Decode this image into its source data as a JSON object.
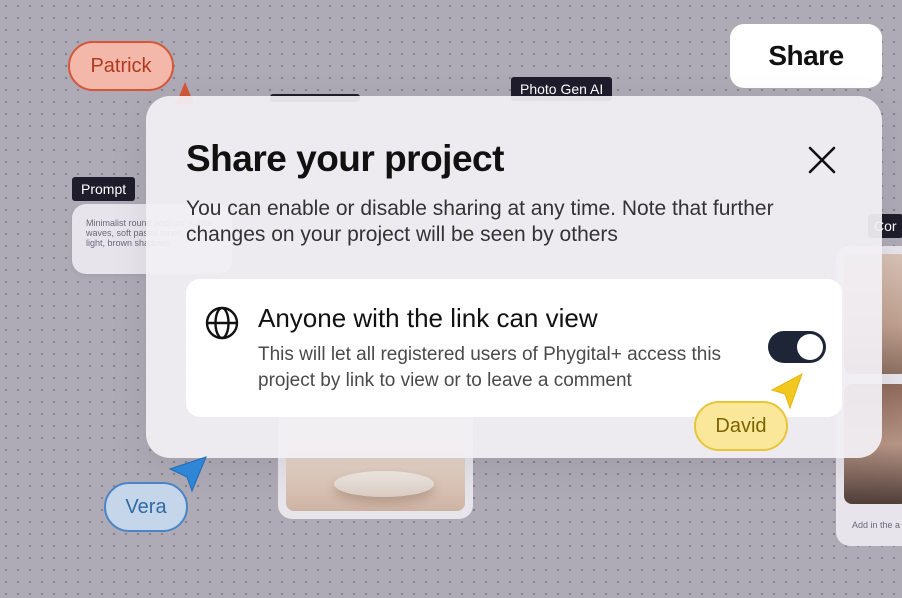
{
  "canvas": {
    "prompt_tag": "Prompt",
    "prompt_text": "Minimalist round podium, subtle waves, soft pastel tones, warm light, brown shadows",
    "photo_gen_tag": "Photo Gen AI",
    "right_tag": "Cor",
    "right_caption": "Add in the a"
  },
  "collaborators": {
    "patrick": "Patrick",
    "vera": "Vera",
    "david": "David"
  },
  "share_button": "Share",
  "modal": {
    "title": "Share your project",
    "description": "You can enable or disable sharing at any time. Note that further changes on your project will be seen by others",
    "option": {
      "title": "Anyone with the link can view",
      "description": "This will let all registered users of Phygital+ access this project by link to view or to leave a comment",
      "enabled": true,
      "icon": "globe-icon"
    }
  },
  "colors": {
    "patrick": "#d4573a",
    "vera": "#4a86c5",
    "david": "#e7c53a",
    "toggle_on": "#1e2537"
  }
}
